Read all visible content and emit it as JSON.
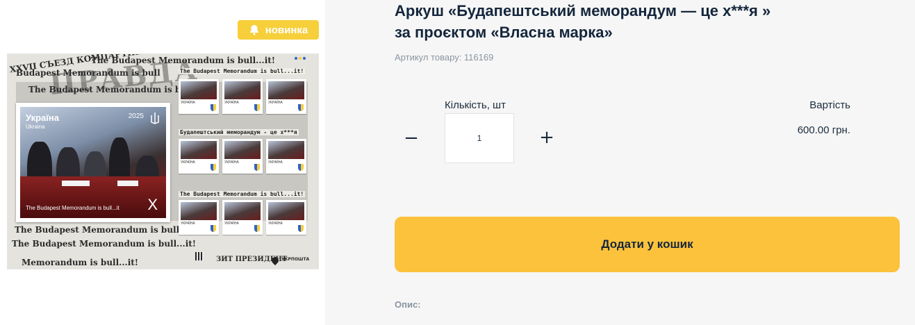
{
  "badge": {
    "label": "новинка",
    "icon": "bell-icon",
    "color": "#f6cf3a"
  },
  "product_image": {
    "pravda_text": "ПРАВДА",
    "news_lines": [
      "XXVII СЪЕЗД КОМПАРТИИ",
      "The Budapest Memorandum is bull...it!",
      "Budapest Memorandum is bull",
      "The Budapest Memorandum is bull...it!",
      "The Budapest Memorandum is bull...it!",
      "The Budapest Memorandum is bull...it!",
      "Memorandum is bull...it!",
      "ЗИТ ПРЕЗИДЕНТ"
    ],
    "stamp": {
      "country": "Україна",
      "country_sub": "Ukraina",
      "year": "2025",
      "caption": "The Budapest Memorandum is bull...it",
      "value": "X"
    },
    "row_titles": [
      "The Budapest Memorandum is bull...it!",
      "Будапештський меморандум - це х***я",
      "The Budapest Memorandum is bull...it!"
    ],
    "mini_label": "УКРАЇНА",
    "footer_brand": "УКРПОШТА"
  },
  "product": {
    "title": "Аркуш «Будапештський меморандум — це х***я » за проєктом «Власна марка»",
    "sku_label": "Артикул товару: 116169"
  },
  "quantity": {
    "label": "Кількість, шт",
    "value": "1",
    "minus": "−",
    "plus": "+"
  },
  "price": {
    "label": "Вартість",
    "value": "600.00 грн."
  },
  "cart": {
    "button_label": "Додати у кошик",
    "color": "#fcc23b"
  },
  "description": {
    "label": "Опис:"
  }
}
